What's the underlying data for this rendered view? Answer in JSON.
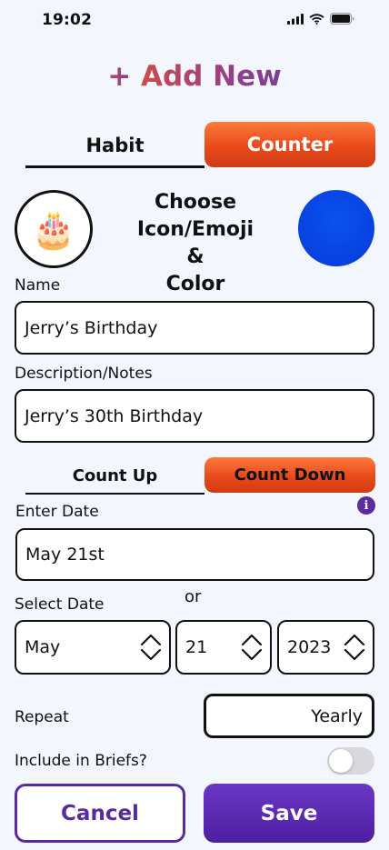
{
  "status": {
    "time": "19:02"
  },
  "header": {
    "plus": "+",
    "title": "Add New"
  },
  "main_tabs": [
    {
      "label": "Habit",
      "selected": false
    },
    {
      "label": "Counter",
      "selected": true
    }
  ],
  "icon_picker": {
    "emoji": "🎂",
    "line1": "Choose Icon/Emoji",
    "line2": "&",
    "line3": "Color",
    "color": "#0a4ae8"
  },
  "name": {
    "label": "Name",
    "value": "Jerry’s Birthday"
  },
  "description": {
    "label": "Description/Notes",
    "value": "Jerry’s 30th Birthday"
  },
  "count_tabs": [
    {
      "label": "Count Up",
      "selected": false
    },
    {
      "label": "Count Down",
      "selected": true
    }
  ],
  "enter_date": {
    "label": "Enter Date",
    "value": "May 21st",
    "info_glyph": "i"
  },
  "or_text": "or",
  "select_date": {
    "label": "Select Date",
    "month": "May",
    "day": "21",
    "year": "2023"
  },
  "repeat": {
    "label": "Repeat",
    "value": "Yearly"
  },
  "briefs": {
    "label": "Include in Briefs?",
    "enabled": false
  },
  "actions": {
    "cancel": "Cancel",
    "save": "Save"
  },
  "colors": {
    "accent_orange": "#e8491a",
    "accent_purple": "#5a2aa3",
    "background": "#f4f6fe"
  }
}
